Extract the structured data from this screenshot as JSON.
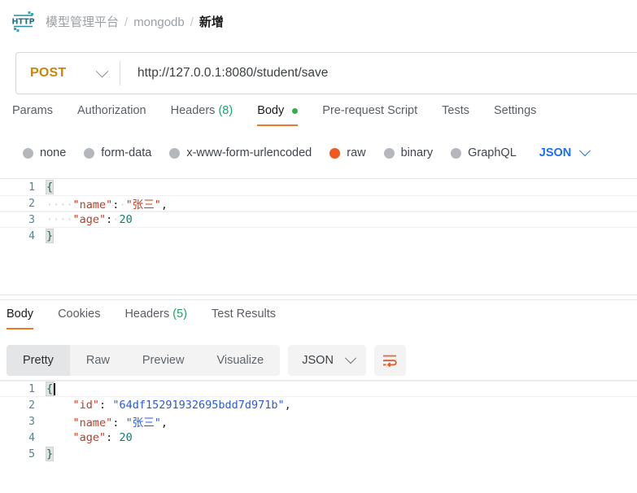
{
  "breadcrumb": {
    "icon": "http-protocol-icon",
    "items": [
      {
        "label": "模型管理平台",
        "current": false
      },
      {
        "label": "mongodb",
        "current": false
      },
      {
        "label": "新增",
        "current": true
      }
    ],
    "separator": "/"
  },
  "url_bar": {
    "method": "POST",
    "method_chevron": "chevron-down-icon",
    "url": "http://127.0.0.1:8080/student/save"
  },
  "request_tabs": [
    {
      "label": "Params",
      "active": false
    },
    {
      "label": "Authorization",
      "active": false
    },
    {
      "label": "Headers",
      "count": "(8)",
      "active": false
    },
    {
      "label": "Body",
      "active": true,
      "dot": true
    },
    {
      "label": "Pre-request Script",
      "active": false
    },
    {
      "label": "Tests",
      "active": false
    },
    {
      "label": "Settings",
      "active": false
    }
  ],
  "body_options": {
    "items": [
      {
        "label": "none",
        "selected": false
      },
      {
        "label": "form-data",
        "selected": false
      },
      {
        "label": "x-www-form-urlencoded",
        "selected": false
      },
      {
        "label": "raw",
        "selected": true
      },
      {
        "label": "binary",
        "selected": false
      },
      {
        "label": "GraphQL",
        "selected": false
      }
    ],
    "format": "JSON",
    "format_chevron": "chevron-down-icon"
  },
  "request_body": {
    "language": "json",
    "lines": [
      {
        "num": "1",
        "open_brace": "{"
      },
      {
        "num": "2",
        "indent": "····",
        "key": "\"name\"",
        "colon": ":",
        "value": "\"张三\"",
        "value_type": "string-red",
        "trail": ","
      },
      {
        "num": "3",
        "indent": "····",
        "key": "\"age\"",
        "colon": ":",
        "value": "20",
        "value_type": "number",
        "trail": ""
      },
      {
        "num": "4",
        "close_brace": "}"
      }
    ]
  },
  "response_tabs": [
    {
      "label": "Body",
      "active": true
    },
    {
      "label": "Cookies",
      "active": false
    },
    {
      "label": "Headers",
      "count": "(5)",
      "active": false
    },
    {
      "label": "Test Results",
      "active": false
    }
  ],
  "response_toolbar": {
    "segments": [
      {
        "label": "Pretty",
        "active": true
      },
      {
        "label": "Raw",
        "active": false
      },
      {
        "label": "Preview",
        "active": false
      },
      {
        "label": "Visualize",
        "active": false
      }
    ],
    "format": "JSON",
    "format_chevron": "chevron-down-icon",
    "wrap_button": "wrap-lines-icon"
  },
  "response_body": {
    "language": "json",
    "lines": [
      {
        "num": "1",
        "open_brace": "{"
      },
      {
        "num": "2",
        "indent": "    ",
        "key": "\"id\"",
        "colon": ":",
        "value": "\"64df15291932695bdd7d971b\"",
        "value_type": "string-blue",
        "trail": ","
      },
      {
        "num": "3",
        "indent": "    ",
        "key": "\"name\"",
        "colon": ":",
        "value": "\"张三\"",
        "value_type": "string-blue",
        "trail": ","
      },
      {
        "num": "4",
        "indent": "    ",
        "key": "\"age\"",
        "colon": ":",
        "value": "20",
        "value_type": "number",
        "trail": ""
      },
      {
        "num": "5",
        "close_brace": "}"
      }
    ]
  },
  "colors": {
    "accent_orange": "#f4732a",
    "method_amber": "#c9860b",
    "link_blue": "#1a6ef0",
    "count_green": "#22a06b",
    "dot_green": "#2eaf4e",
    "radio_selected": "#f4561f",
    "icon_teal": "#2a8a9e"
  }
}
